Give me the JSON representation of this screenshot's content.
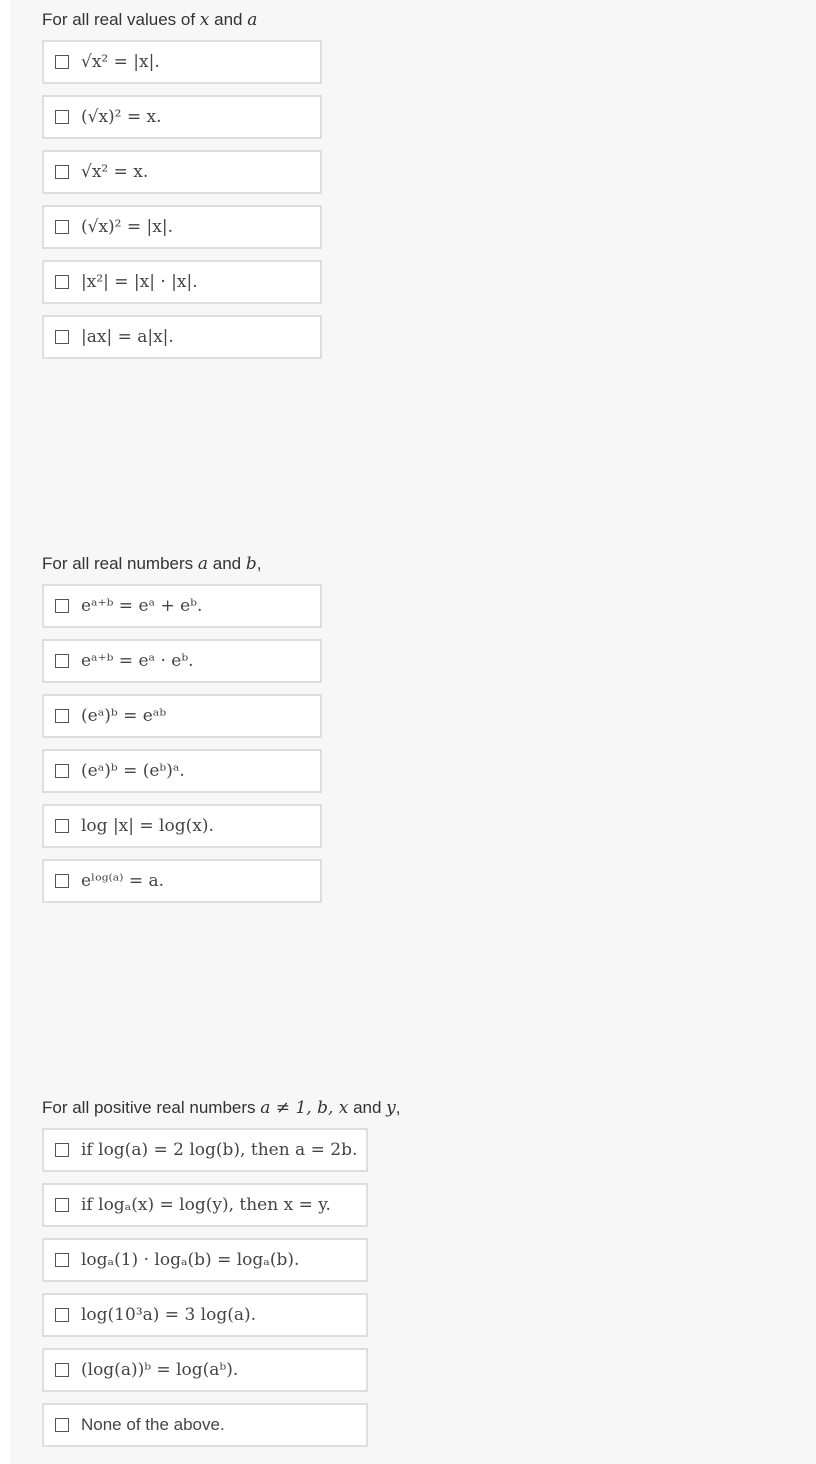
{
  "sections": [
    {
      "prompt_prefix": "For all real values of ",
      "prompt_var1": "x",
      "prompt_mid": " and ",
      "prompt_var2": "a",
      "prompt_suffix": "",
      "options": [
        "√x² = |x|.",
        "(√x)² = x.",
        "√x² = x.",
        "(√x)² = |x|.",
        "|x²| = |x| · |x|.",
        "|ax| = a|x|."
      ]
    },
    {
      "prompt_prefix": "For all real numbers ",
      "prompt_var1": "a",
      "prompt_mid": " and ",
      "prompt_var2": "b",
      "prompt_suffix": ",",
      "options": [
        "eᵃ⁺ᵇ = eᵃ + eᵇ.",
        "eᵃ⁺ᵇ = eᵃ · eᵇ.",
        "(eᵃ)ᵇ = eᵃᵇ",
        "(eᵃ)ᵇ = (eᵇ)ᵃ.",
        "log |x| = log(x).",
        "eˡᵒᵍ⁽ᵃ⁾ = a."
      ]
    },
    {
      "prompt_prefix": "For all positive real numbers ",
      "prompt_vars": "a ≠ 1, b, x",
      "prompt_mid": " and ",
      "prompt_var2": "y",
      "prompt_suffix": ",",
      "options": [
        "if log(a) = 2 log(b), then a = 2b.",
        "if logₐ(x) = log(y), then x = y.",
        "logₐ(1) · logₐ(b) = logₐ(b).",
        "log(10³a) = 3 log(a).",
        "(log(a))ᵇ = log(aᵇ).",
        "None of the above."
      ]
    }
  ]
}
